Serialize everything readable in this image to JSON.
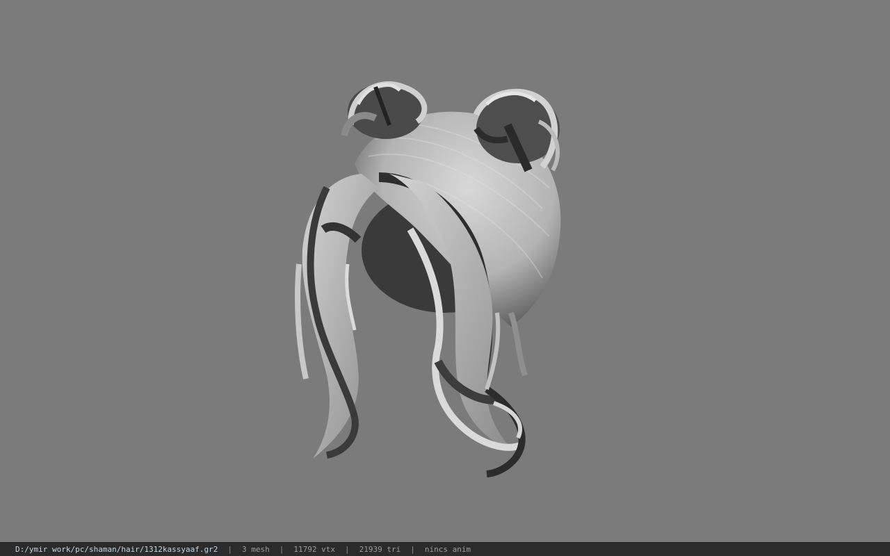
{
  "viewport": {
    "background": "#7b7b7b",
    "model_icon": "hair-model-icon"
  },
  "status_bar": {
    "file_path": "D:/ymir work/pc/shaman/hair/1312kassyaaf.gr2",
    "separator": "|",
    "mesh": "3 mesh",
    "vertices": "11792 vtx",
    "triangles": "21939 tri",
    "animation": "nincs anim"
  }
}
